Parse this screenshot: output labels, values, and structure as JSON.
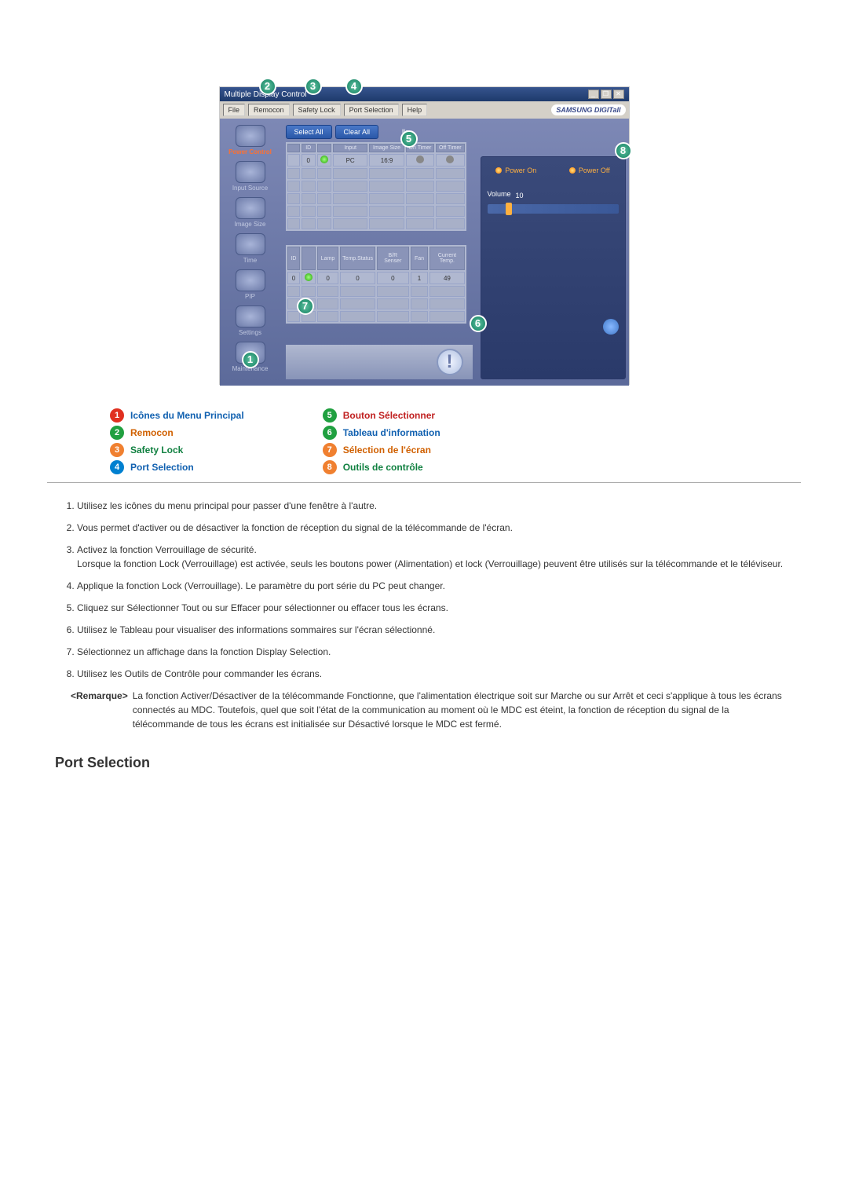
{
  "app": {
    "title": "Multiple Display Control",
    "winbtns": {
      "min": "_",
      "restore": "❐",
      "close": "✕"
    },
    "menu": [
      "File",
      "Remocon",
      "Safety Lock",
      "Port Selection",
      "Help"
    ],
    "samsung": "SAMSUNG DIGITall"
  },
  "sidebar": {
    "items": [
      {
        "label": "Power Control",
        "active": true
      },
      {
        "label": "Input Source"
      },
      {
        "label": "Image Size"
      },
      {
        "label": "Time"
      },
      {
        "label": "PIP"
      },
      {
        "label": "Settings"
      },
      {
        "label": "Maintenance"
      }
    ]
  },
  "toolbar": {
    "select_all": "Select All",
    "clear_all": "Clear All",
    "nle": "lle"
  },
  "table1": {
    "headers": [
      "",
      "ID",
      "",
      "Input",
      "Image Size",
      "On Timer",
      "Off Timer"
    ],
    "row": {
      "id": "0",
      "input": "PC",
      "size": "16:9"
    }
  },
  "table2": {
    "headers": [
      "ID",
      "",
      "Lamp",
      "Temp.Status",
      "B/R Senser",
      "Fan",
      "Current Temp."
    ],
    "row": {
      "id": "0",
      "lamp": "0",
      "temp_status": "0",
      "br": "0",
      "fan": "1",
      "ct": "49"
    }
  },
  "panel": {
    "power_on": "Power On",
    "power_off": "Power Off",
    "volume_label": "Volume",
    "volume_value": "10"
  },
  "footer": {
    "info": "!"
  },
  "callouts": {
    "c1": "1",
    "c2": "2",
    "c3": "3",
    "c4": "4",
    "c5": "5",
    "c6": "6",
    "c7": "7",
    "c8": "8"
  },
  "legend": [
    {
      "num": "1",
      "ncolor": "c-red",
      "text": "Icônes du Menu Principal",
      "tcolor": "t-blue"
    },
    {
      "num": "2",
      "ncolor": "c-green",
      "text": "Remocon",
      "tcolor": "t-orange"
    },
    {
      "num": "3",
      "ncolor": "c-orange",
      "text": "Safety Lock",
      "tcolor": "t-green"
    },
    {
      "num": "4",
      "ncolor": "c-blue",
      "text": "Port Selection",
      "tcolor": "t-blue"
    },
    {
      "num": "5",
      "ncolor": "c-green",
      "text": "Bouton Sélectionner",
      "tcolor": "t-red"
    },
    {
      "num": "6",
      "ncolor": "c-green",
      "text": "Tableau d'information",
      "tcolor": "t-blue"
    },
    {
      "num": "7",
      "ncolor": "c-orange",
      "text": "Sélection de l'écran",
      "tcolor": "t-orange"
    },
    {
      "num": "8",
      "ncolor": "c-orange",
      "text": "Outils de contrôle",
      "tcolor": "t-green"
    }
  ],
  "descriptions": [
    "Utilisez les icônes du menu principal pour passer d'une fenêtre à l'autre.",
    "Vous permet d'activer ou de désactiver la fonction de réception du signal de la télécommande de l'écran.",
    "Activez la fonction Verrouillage de sécurité.\nLorsque la fonction Lock (Verrouillage) est activée, seuls les boutons power (Alimentation) et lock (Verrouillage) peuvent être utilisés sur la télécommande et le téléviseur.",
    "Applique la fonction Lock (Verrouillage). Le paramètre du port série du PC peut changer.",
    "Cliquez sur Sélectionner Tout ou sur Effacer pour sélectionner ou effacer tous les écrans.",
    "Utilisez le Tableau pour visualiser des informations sommaires sur l'écran sélectionné.",
    "Sélectionnez un affichage dans la fonction Display Selection.",
    "Utilisez les Outils de Contrôle pour commander les écrans."
  ],
  "remark": {
    "label": "<Remarque>",
    "text": "La fonction Activer/Désactiver de la télécommande Fonctionne, que l'alimentation électrique soit sur Marche ou sur Arrêt et ceci s'applique à tous les écrans connectés au MDC. Toutefois, quel que soit l'état de la communication au moment où le MDC est éteint, la fonction de réception du signal de la télécommande de tous les écrans est initialisée sur Désactivé lorsque le MDC est fermé."
  },
  "section_heading": "Port Selection"
}
